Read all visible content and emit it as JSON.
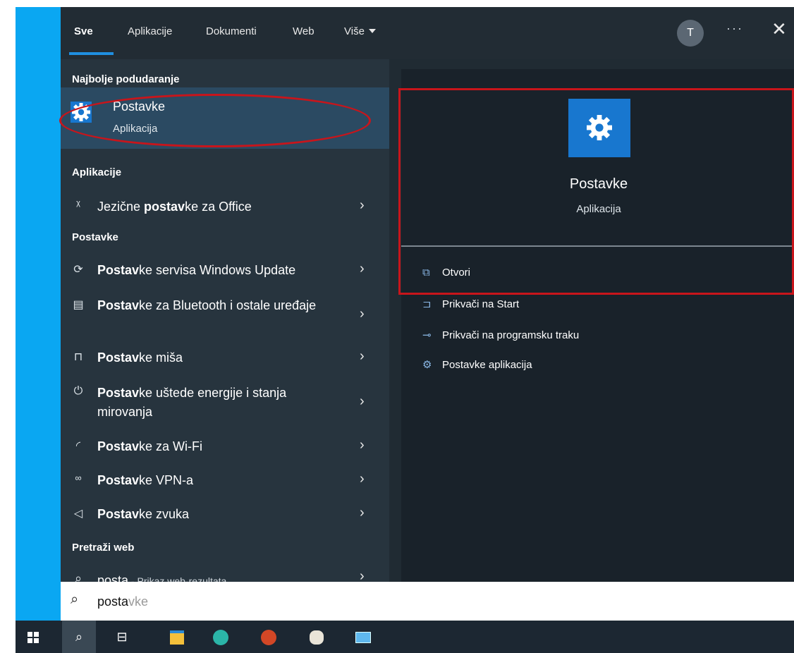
{
  "tabs": {
    "all": "Sve",
    "apps": "Aplikacije",
    "docs": "Dokumenti",
    "web": "Web",
    "more": "Više"
  },
  "header": {
    "avatar": "T",
    "more": "···",
    "close": "✕"
  },
  "sections": {
    "best": "Najbolje podudaranje",
    "apps": "Aplikacije",
    "settings": "Postavke",
    "web": "Pretraži web"
  },
  "best_match": {
    "title": "Postavke",
    "subtitle": "Aplikacija"
  },
  "app_results": [
    {
      "pre": "Jezične ",
      "bold": "postav",
      "post": "ke za Office",
      "icon": "language-icon"
    }
  ],
  "settings_results": [
    {
      "pre": "",
      "bold": "Postav",
      "post": "ke servisa Windows Update",
      "icon": "refresh-icon"
    },
    {
      "pre": "",
      "bold": "Postav",
      "post": "ke za Bluetooth i ostale uređaje",
      "icon": "bluetooth-devices-icon"
    },
    {
      "pre": "",
      "bold": "Postav",
      "post": "ke miša",
      "icon": "mouse-icon"
    },
    {
      "pre": "",
      "bold": "Postav",
      "post": "ke uštede energije i stanja mirovanja",
      "icon": "power-icon"
    },
    {
      "pre": "",
      "bold": "Postav",
      "post": "ke za Wi-Fi",
      "icon": "wifi-icon"
    },
    {
      "pre": "",
      "bold": "Postav",
      "post": "ke VPN-a",
      "icon": "vpn-icon"
    },
    {
      "pre": "",
      "bold": "Postav",
      "post": "ke zvuka",
      "icon": "speaker-icon"
    }
  ],
  "web_result": {
    "query": "posta",
    "suffix": " - Prikaz web-rezultata"
  },
  "preview": {
    "title": "Postavke",
    "subtitle": "Aplikacija",
    "actions": [
      {
        "label": "Otvori",
        "icon": "open-icon"
      },
      {
        "label": "Prikvači na Start",
        "icon": "pin-icon"
      },
      {
        "label": "Prikvači na programsku traku",
        "icon": "pin-taskbar-icon"
      },
      {
        "label": "Postavke aplikacija",
        "icon": "gear-icon"
      }
    ]
  },
  "search": {
    "typed": "posta",
    "completion": "vke"
  },
  "colors": {
    "accent": "#1877cf",
    "highlight": "#c8151b",
    "selected": "#2b4a62",
    "desktop": "#0aa7f2"
  }
}
